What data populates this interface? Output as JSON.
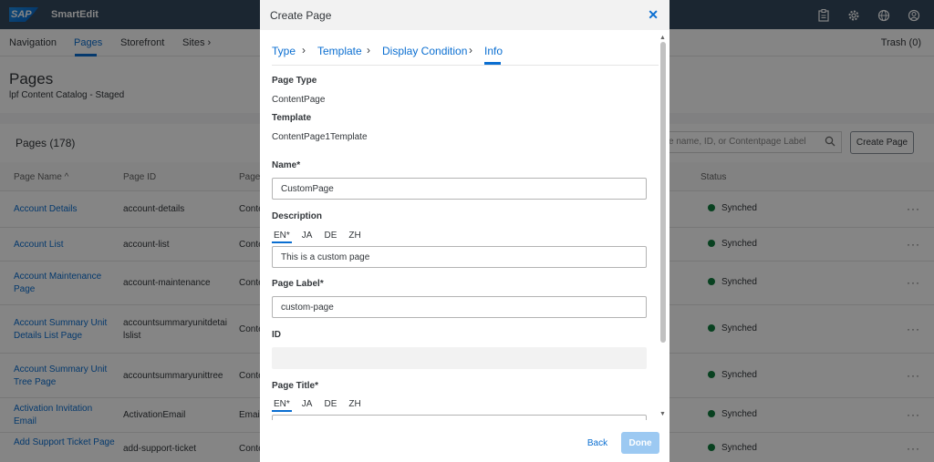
{
  "shell": {
    "logo": "SAP",
    "app_name": "SmartEdit",
    "icons": [
      "clipboard-icon",
      "gear-icon",
      "globe-icon",
      "user-icon"
    ]
  },
  "nav": {
    "items": [
      "Navigation",
      "Pages",
      "Storefront",
      "Sites"
    ],
    "active": "Pages",
    "sites_chevron": "›",
    "trash": "Trash (0)"
  },
  "header": {
    "title": "Pages",
    "subtitle": "lpf Content Catalog - Staged"
  },
  "table": {
    "count_label": "Pages (178)",
    "search_placeholder": "e name, ID, or Contentpage Label",
    "create_button": "Create Page",
    "columns": [
      "Page Name",
      "Page ID",
      "Page",
      "Status"
    ],
    "sort_indicator": "^",
    "rows": [
      {
        "name": "Account Details",
        "id": "account-details",
        "type": "Conte",
        "status": "Synched"
      },
      {
        "name": "Account List",
        "id": "account-list",
        "type": "Conte",
        "status": "Synched"
      },
      {
        "name": "Account Maintenance Page",
        "id": "account-maintenance",
        "type": "Conte",
        "status": "Synched"
      },
      {
        "name": "Account Summary Unit Details List Page",
        "id": "accountsummaryunitdetailslist",
        "type": "Conte",
        "status": "Synched"
      },
      {
        "name": "Account Summary Unit Tree Page",
        "id": "accountsummaryunittree",
        "type": "Conte",
        "status": "Synched"
      },
      {
        "name": "Activation Invitation Email",
        "id": "ActivationEmail",
        "type": "Email",
        "status": "Synched"
      },
      {
        "name": "Add Support Ticket Page",
        "id": "add-support-ticket",
        "type": "Conte",
        "status": "Synched"
      }
    ],
    "more": "···"
  },
  "modal": {
    "title": "Create Page",
    "close": "✕",
    "steps": [
      "Type",
      "Template",
      "Display Condition",
      "Info"
    ],
    "active_step": "Info",
    "page_type_label": "Page Type",
    "page_type_value": "ContentPage",
    "template_label": "Template",
    "template_value": "ContentPage1Template",
    "name_label": "Name",
    "name_value": "CustomPage",
    "description_label": "Description",
    "languages": [
      "EN*",
      "JA",
      "DE",
      "ZH"
    ],
    "description_value": "This is a custom page",
    "page_label_label": "Page Label",
    "page_label_value": "custom-page",
    "id_label": "ID",
    "id_value": "",
    "page_title_label": "Page Title",
    "required_mark": "*",
    "back_button": "Back",
    "done_button": "Done"
  },
  "colors": {
    "shell_bg": "#354a5f",
    "accent": "#0a6ed1",
    "success": "#107e3e",
    "done_disabled": "#9cc9f2"
  }
}
